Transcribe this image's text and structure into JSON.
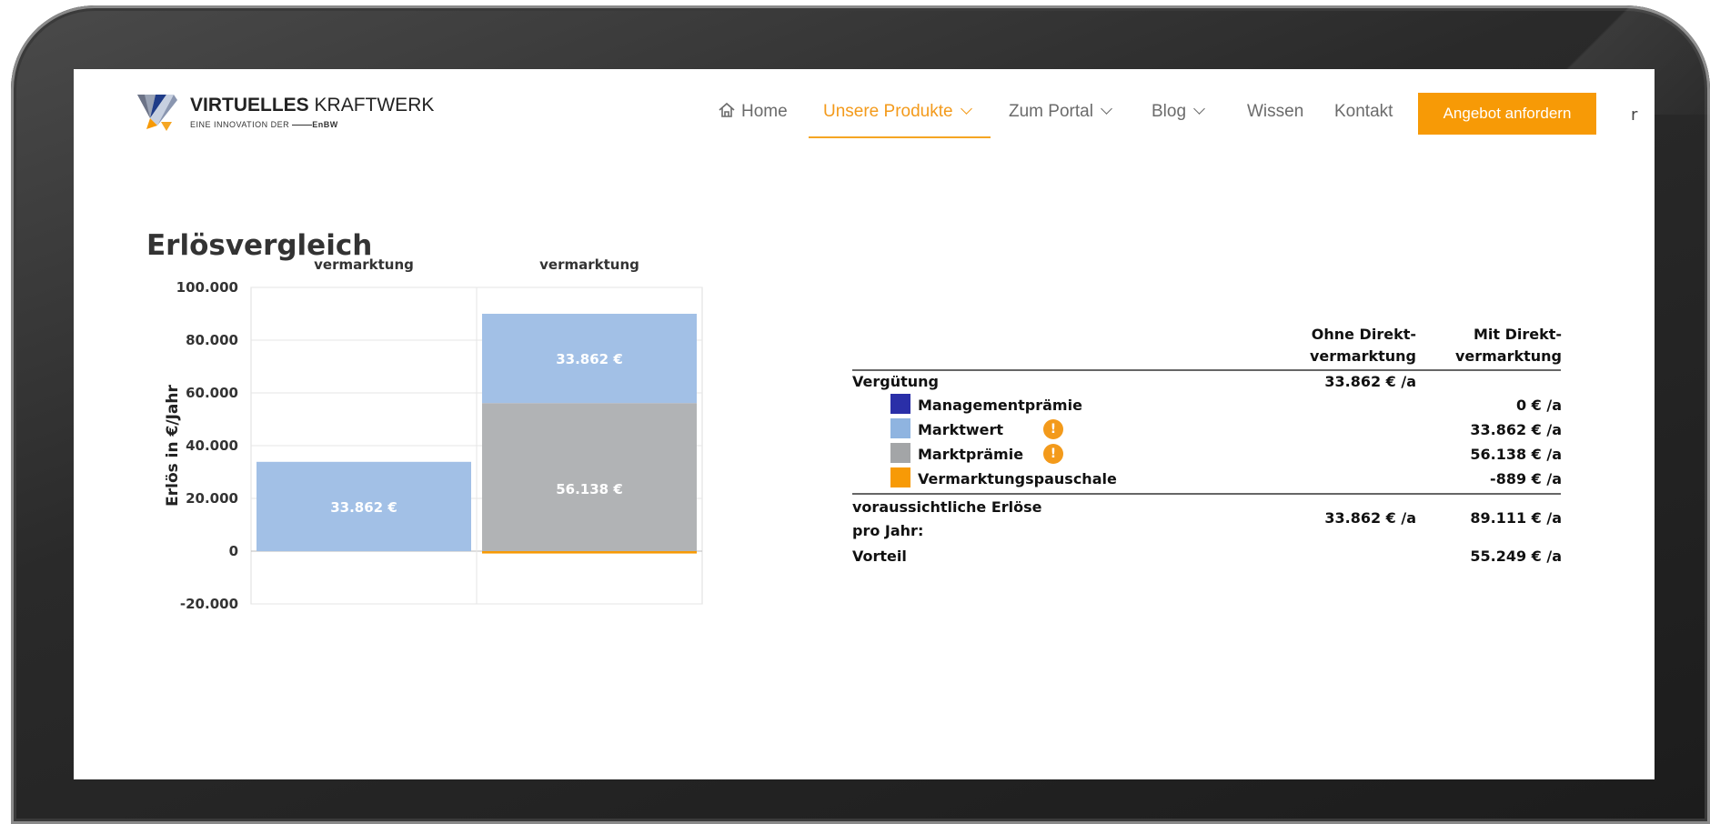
{
  "logo": {
    "title_bold": "VIRTUELLES",
    "title_rest": "KRAFTWERK",
    "subtitle": "EINE INNOVATION DER",
    "brand": "EnBW"
  },
  "nav": {
    "home": "Home",
    "items": [
      "Unsere Produkte",
      "Zum Portal",
      "Blog",
      "Wissen",
      "Kontakt"
    ],
    "cta": "Angebot anfordern",
    "extra": "r"
  },
  "page": {
    "title": "Erlösvergleich"
  },
  "chart_data": {
    "type": "bar",
    "stacked": true,
    "categories": [
      "Ohne Direkt-vermarktung",
      "Mit Direkt-vermarktung"
    ],
    "category_lines": [
      [
        "Ohne Direkt-",
        "vermarktung"
      ],
      [
        "Mit Direkt-",
        "vermarktung"
      ]
    ],
    "ylabel": "Erlös in €/Jahr",
    "ylim": [
      -20000,
      100000
    ],
    "yticks": [
      100000,
      80000,
      60000,
      40000,
      20000,
      0,
      -20000
    ],
    "ytick_labels": [
      "100.000",
      "80.000",
      "60.000",
      "40.000",
      "20.000",
      "0",
      "-20.000"
    ],
    "grid": true,
    "series": [
      {
        "color": "#a2c0e6",
        "values": [
          33862,
          0
        ],
        "labels": [
          "33.862 €",
          ""
        ]
      },
      {
        "color": "#b1b3b5",
        "values": [
          0,
          56138
        ],
        "labels": [
          "",
          "56.138 €"
        ]
      },
      {
        "color": "#a2c0e6",
        "values": [
          0,
          33862
        ],
        "labels": [
          "",
          "33.862 €"
        ]
      },
      {
        "color": "#f79a06",
        "values": [
          0,
          -889
        ],
        "labels": [
          "",
          ""
        ]
      }
    ]
  },
  "table": {
    "col1": [
      "Ohne Direkt-",
      "vermarktung"
    ],
    "col2": [
      "Mit Direkt-",
      "vermarktung"
    ],
    "verguetung_label": "Vergütung",
    "verguetung_value": "33.862 € /a",
    "rows": [
      {
        "label": "Managementprämie",
        "value": "0 € /a",
        "color": "#2a2fa8",
        "info": false
      },
      {
        "label": "Marktwert",
        "value": "33.862 € /a",
        "color": "#8fb4e0",
        "info": true
      },
      {
        "label": "Marktprämie",
        "value": "56.138 € /a",
        "color": "#a3a5a7",
        "info": true
      },
      {
        "label": "Vermarktungspauschale",
        "value": "-889 € /a",
        "color": "#f79a06",
        "info": false
      }
    ],
    "info_glyph": "!",
    "totals_label_1": "voraussichtliche Erlöse",
    "totals_label_2": "pro Jahr:",
    "totals_col1": "33.862 € /a",
    "totals_col2": "89.111 € /a",
    "vorteil_label": "Vorteil",
    "vorteil_value": "55.249 € /a"
  }
}
